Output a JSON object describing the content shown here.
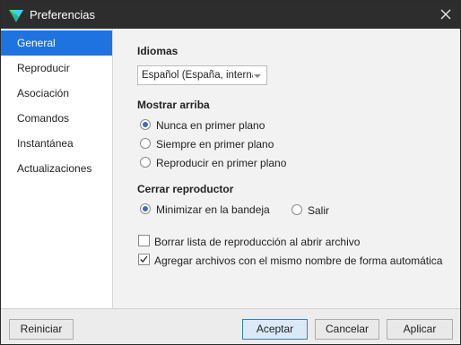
{
  "window": {
    "title": "Preferencias"
  },
  "sidebar": {
    "items": [
      {
        "label": "General"
      },
      {
        "label": "Reproducir"
      },
      {
        "label": "Asociación"
      },
      {
        "label": "Comandos"
      },
      {
        "label": "Instantánea"
      },
      {
        "label": "Actualizaciones"
      }
    ],
    "active": "General"
  },
  "idiomas": {
    "title": "Idiomas",
    "selected": "Español (España, internacional)"
  },
  "mostrar_arriba": {
    "title": "Mostrar arriba",
    "options": [
      "Nunca en primer plano",
      "Siempre en primer plano",
      "Reproducir en primer plano"
    ],
    "selected": "Nunca en primer plano"
  },
  "cerrar_reproductor": {
    "title": "Cerrar reproductor",
    "options": [
      "Minimizar en la bandeja",
      "Salir"
    ],
    "selected": "Minimizar en la bandeja"
  },
  "checkboxes": [
    {
      "label": "Borrar lista de reproducción al abrir archivo",
      "checked": false
    },
    {
      "label": "Agregar archivos con el mismo nombre de forma automática",
      "checked": true
    }
  ],
  "footer": {
    "reset": "Reiniciar",
    "accept": "Aceptar",
    "cancel": "Cancelar",
    "apply": "Aplicar"
  },
  "colors": {
    "accent": "#1e73e0",
    "titlebar": "#2d2d2d"
  },
  "icons": {
    "app": "app-logo-icon",
    "close": "close-icon",
    "check": "checkmark-icon"
  }
}
